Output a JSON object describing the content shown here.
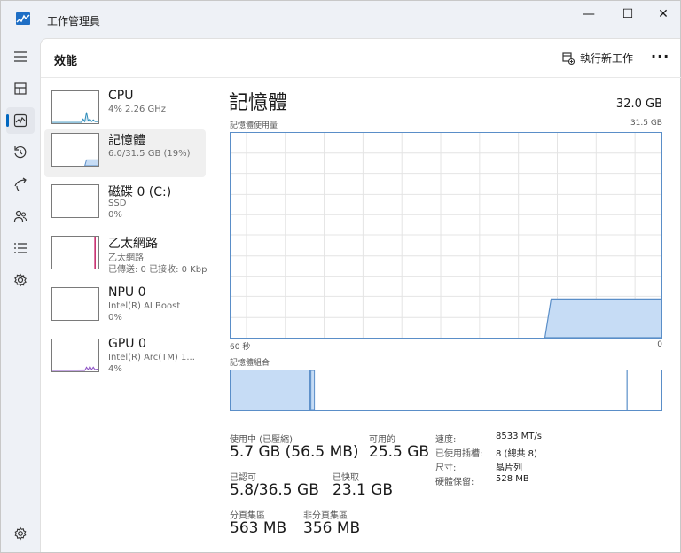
{
  "app": {
    "title": "工作管理員"
  },
  "window_controls": {
    "minimize": "—",
    "maximize": "☐",
    "close": "✕"
  },
  "rail": {
    "items": [
      {
        "icon": "hamburger-icon",
        "glyph": "≡"
      },
      {
        "icon": "processes-icon",
        "glyph": "▦"
      },
      {
        "icon": "performance-icon",
        "glyph": "⌇",
        "active": true
      },
      {
        "icon": "app-history-icon",
        "glyph": "↺"
      },
      {
        "icon": "startup-apps-icon",
        "glyph": "➶"
      },
      {
        "icon": "users-icon",
        "glyph": "⚇"
      },
      {
        "icon": "details-icon",
        "glyph": "☰"
      },
      {
        "icon": "services-icon",
        "glyph": "⚙"
      }
    ],
    "settings_glyph": "⚙"
  },
  "header": {
    "title": "效能",
    "run_task": "執行新工作",
    "more": "···"
  },
  "resources": [
    {
      "name": "CPU",
      "sub1": "4%  2.26 GHz",
      "sub2": "",
      "sub3": ""
    },
    {
      "name": "記憶體",
      "sub1": "6.0/31.5 GB (19%)",
      "sub2": "",
      "sub3": ""
    },
    {
      "name": "磁碟 0 (C:)",
      "sub1": "SSD",
      "sub2": "0%",
      "sub3": ""
    },
    {
      "name": "乙太網路",
      "sub1": "乙太網路",
      "sub2": "已傳送: 0 已接收: 0 Kbps",
      "sub3": ""
    },
    {
      "name": "NPU 0",
      "sub1": "Intel(R) AI Boost",
      "sub2": "0%",
      "sub3": ""
    },
    {
      "name": "GPU 0",
      "sub1": "Intel(R) Arc(TM) 1...",
      "sub2": "4%",
      "sub3": ""
    }
  ],
  "detail": {
    "title": "記憶體",
    "total": "32.0 GB",
    "graph_label": "記憶體使用量",
    "graph_max": "31.5 GB",
    "graph_left": "60 秒",
    "graph_right": "0",
    "composition_label": "記憶體組合",
    "usage_fraction": 0.19
  },
  "stats": {
    "in_use_label": "使用中 (已壓縮)",
    "in_use": "5.7 GB (56.5 MB)",
    "available_label": "可用的",
    "available": "25.5 GB",
    "committed_label": "已認可",
    "committed": "5.8/36.5 GB",
    "cached_label": "已快取",
    "cached": "23.1 GB",
    "paged_label": "分頁集區",
    "paged": "563 MB",
    "nonpaged_label": "非分頁集區",
    "nonpaged": "356 MB"
  },
  "specs": [
    {
      "k": "速度:",
      "v": "8533 MT/s"
    },
    {
      "k": "已使用插槽:",
      "v": "8 (總共 8)"
    },
    {
      "k": "尺寸:",
      "v": "晶片列"
    },
    {
      "k": "硬體保留:",
      "v": "528 MB"
    }
  ],
  "colors": {
    "accent": "#0067c0",
    "memory": "#5a8ec8",
    "memory_fill": "#c6dcf5",
    "ethernet": "#c3185f",
    "gpu": "#8b4fc4",
    "cpu": "#2a8ab8"
  }
}
